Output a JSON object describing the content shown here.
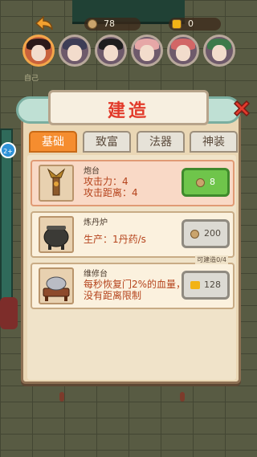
{
  "topbar": {
    "coins": "78",
    "gold": "0",
    "self_label": "自己"
  },
  "panel": {
    "title": "建造",
    "tabs": [
      {
        "label": "基础",
        "active": true
      },
      {
        "label": "致富",
        "active": false
      },
      {
        "label": "法器",
        "active": false
      },
      {
        "label": "神装",
        "active": false
      }
    ]
  },
  "items": [
    {
      "name": "炮台",
      "desc_line1": "攻击力：4",
      "desc_line2": "攻击距离：4",
      "cost": "8",
      "cost_icon": "coin-icon"
    },
    {
      "name": "炼丹炉",
      "desc_line1": "生产：1丹药/s",
      "desc_line2": "",
      "cost": "200",
      "cost_icon": "coin-icon"
    },
    {
      "name": "维修台",
      "desc_line1": "每秒恢复门2%的血量，没有距离限制",
      "desc_line2": "",
      "cost": "128",
      "cost_icon": "gold-icon",
      "availability": "可建造0/4"
    }
  ],
  "side_badge": "2+"
}
